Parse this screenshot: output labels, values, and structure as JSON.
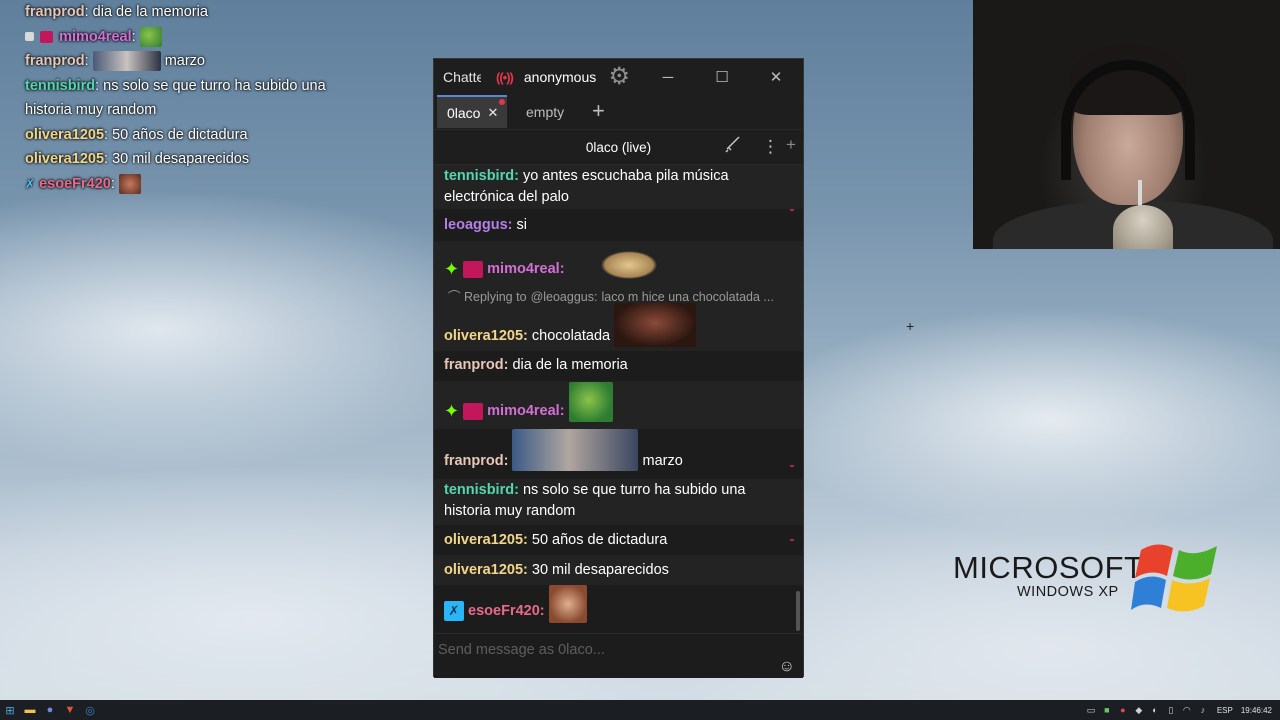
{
  "overlay_chat": [
    {
      "user": "franprod",
      "color": "#e6c8b8",
      "text": ": dia de la memoria"
    },
    {
      "user": "mimo4real",
      "color": "#d46fd6",
      "text": ":",
      "emote": "pepe-emote"
    },
    {
      "user": "franprod",
      "color": "#e6c8b8",
      "text": "marzo",
      "emote": "face-photo-emote"
    },
    {
      "user": "tennisbird",
      "color": "#55d6ae",
      "text": ": ns solo se que turro ha subido una historia muy random"
    },
    {
      "user": "olivera1205",
      "color": "#f2d68a",
      "text": ": 50 años de dictadura"
    },
    {
      "user": "olivera1205",
      "color": "#f2d68a",
      "text": ": 30 mil desaparecidos"
    },
    {
      "user": "esoeFr420",
      "color": "#e86a8c",
      "text": ":",
      "emote": "laugh-emote"
    }
  ],
  "window": {
    "app_title": "Chatterino",
    "account": "anonymous",
    "live_icon": "((•))",
    "minimize": "─",
    "maximize": "☐",
    "close": "✕"
  },
  "tabs": [
    {
      "label": "0laco",
      "active": true
    },
    {
      "label": "empty",
      "active": false
    }
  ],
  "add_tab": "+",
  "split": {
    "title": "0laco (live)",
    "menu": "⋮",
    "add": "+",
    "mod_icon": "sword-icon"
  },
  "messages": [
    {
      "user": "tennisbird",
      "color": "#55d6ae",
      "text": "yo antes escuchaba pila música electrónica del palo"
    },
    {
      "user": "leoaggus",
      "color": "#b57ee8",
      "text": "si"
    },
    {
      "user": "mimo4real",
      "color": "#d46fd6",
      "emote": "cat-emote"
    },
    {
      "reply_label": "Replying to",
      "reply_user": "@leoaggus:",
      "reply_text": "laco m hice una chocolatada ..."
    },
    {
      "user": "olivera1205",
      "color": "#f2d68a",
      "text": "chocolatada",
      "emote": "face-emote"
    },
    {
      "user": "franprod",
      "color": "#e6c8b8",
      "text": "dia de la memoria"
    },
    {
      "user": "mimo4real",
      "color": "#d46fd6",
      "emote": "pepe-emote"
    },
    {
      "user": "franprod",
      "color": "#e6c8b8",
      "text": "marzo",
      "emote": "photo-emote"
    },
    {
      "user": "tennisbird",
      "color": "#55d6ae",
      "text": "ns solo se que turro ha subido una historia muy random"
    },
    {
      "user": "olivera1205",
      "color": "#f2d68a",
      "text": "50 años de dictadura"
    },
    {
      "user": "olivera1205",
      "color": "#f2d68a",
      "text": "30 mil desaparecidos"
    },
    {
      "user": "esoeFr420",
      "color": "#e86a8c",
      "emote": "laugh-emote"
    }
  ],
  "input": {
    "placeholder": "Send message as 0laco..."
  },
  "xp": {
    "word": "MICROSOFT",
    "sub": "WINDOWS XP"
  },
  "taskbar": {
    "lang": "ESP",
    "time": "19:46:42"
  },
  "colors": {
    "accent": "#5c85d6",
    "live": "#e2364a"
  }
}
